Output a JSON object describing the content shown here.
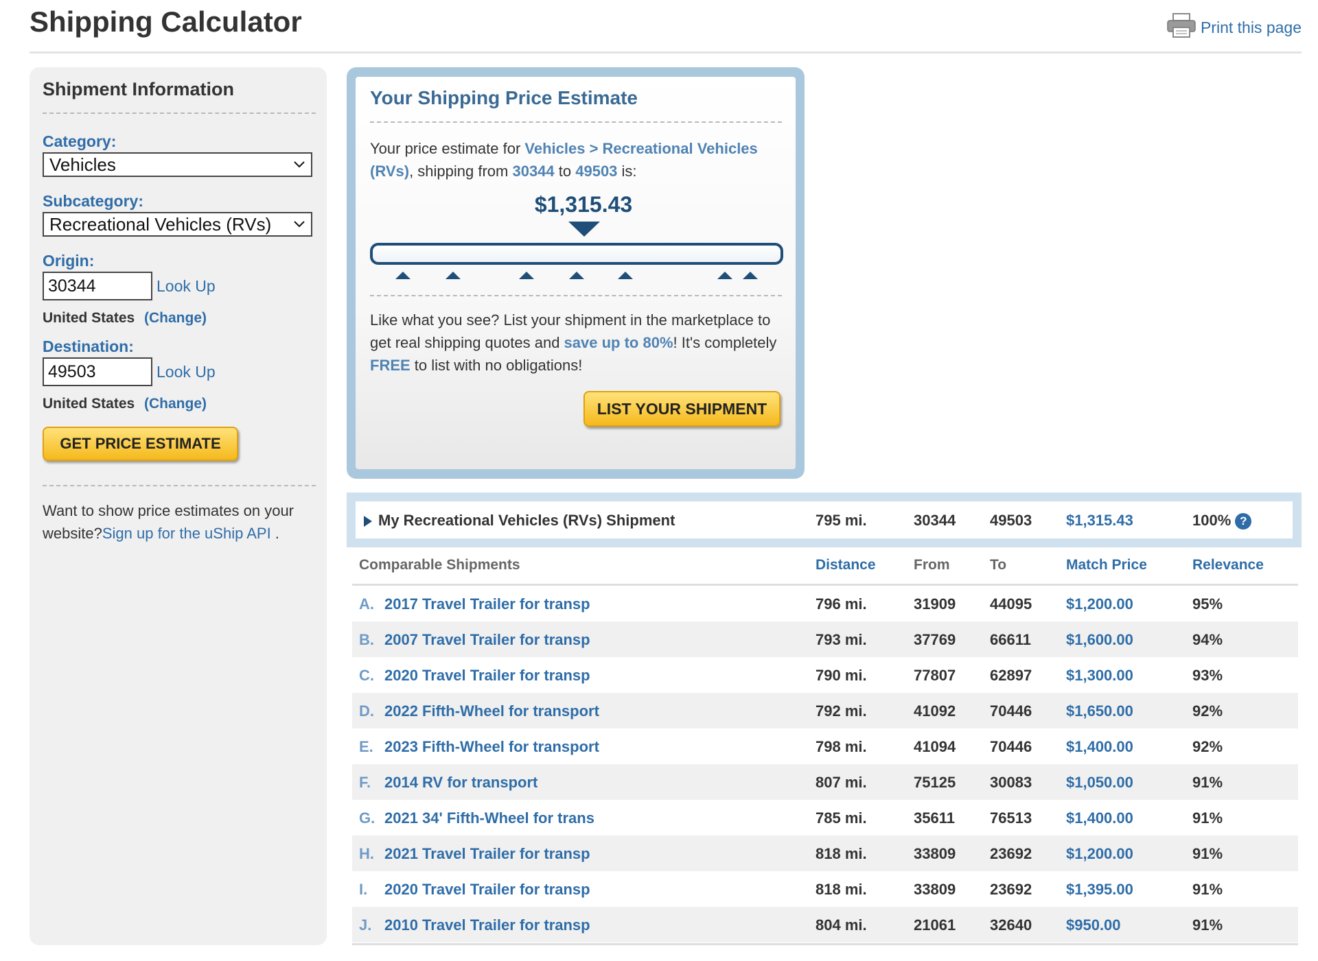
{
  "page": {
    "title": "Shipping Calculator",
    "print_label": "Print this page"
  },
  "sidebar": {
    "heading": "Shipment Information",
    "category_label": "Category:",
    "category_value": "Vehicles",
    "subcategory_label": "Subcategory:",
    "subcategory_value": "Recreational Vehicles (RVs)",
    "origin_label": "Origin:",
    "origin_value": "30344",
    "origin_lookup": "Look Up",
    "origin_country": "United States",
    "origin_change": "(Change)",
    "destination_label": "Destination:",
    "destination_value": "49503",
    "destination_lookup": "Look Up",
    "destination_country": "United States",
    "destination_change": "(Change)",
    "estimate_button": "GET PRICE ESTIMATE",
    "api_text": "Want to show price estimates on your website?",
    "api_link": "Sign up for the uShip API",
    "api_suffix": " ."
  },
  "estimate": {
    "heading": "Your Shipping Price Estimate",
    "intro_prefix": "Your price estimate for ",
    "category_path": "Vehicles > Recreational Vehicles (RVs)",
    "intro_mid1": ", shipping from ",
    "from": "30344",
    "intro_mid2": " to ",
    "to": "49503",
    "intro_suffix": " is:",
    "price": "$1,315.43",
    "cta_text1": "Like what you see? List your shipment in the marketplace to get real shipping quotes and ",
    "cta_highlight1": "save up to 80%",
    "cta_text2": "! It's completely ",
    "cta_highlight2": "FREE",
    "cta_text3": " to list with no obligations!",
    "list_button": "LIST YOUR SHIPMENT"
  },
  "summary": {
    "title": "My Recreational Vehicles (RVs) Shipment",
    "distance": "795 mi.",
    "from": "30344",
    "to": "49503",
    "price": "$1,315.43",
    "relevance": "100%",
    "help_icon": "question-circle-icon"
  },
  "table": {
    "headers": {
      "name": "Comparable Shipments",
      "distance": "Distance",
      "from": "From",
      "to": "To",
      "price": "Match Price",
      "relevance": "Relevance"
    },
    "rows": [
      {
        "letter": "A.",
        "name": "2017 Travel Trailer for transp",
        "distance": "796 mi.",
        "from": "31909",
        "to": "44095",
        "price": "$1,200.00",
        "relevance": "95%"
      },
      {
        "letter": "B.",
        "name": "2007 Travel Trailer for transp",
        "distance": "793 mi.",
        "from": "37769",
        "to": "66611",
        "price": "$1,600.00",
        "relevance": "94%"
      },
      {
        "letter": "C.",
        "name": "2020 Travel Trailer for transp",
        "distance": "790 mi.",
        "from": "77807",
        "to": "62897",
        "price": "$1,300.00",
        "relevance": "93%"
      },
      {
        "letter": "D.",
        "name": "2022 Fifth-Wheel for transport",
        "distance": "792 mi.",
        "from": "41092",
        "to": "70446",
        "price": "$1,650.00",
        "relevance": "92%"
      },
      {
        "letter": "E.",
        "name": "2023 Fifth-Wheel for transport",
        "distance": "798 mi.",
        "from": "41094",
        "to": "70446",
        "price": "$1,400.00",
        "relevance": "92%"
      },
      {
        "letter": "F.",
        "name": "2014 RV for transport",
        "distance": "807 mi.",
        "from": "75125",
        "to": "30083",
        "price": "$1,050.00",
        "relevance": "91%"
      },
      {
        "letter": "G.",
        "name": "2021 34' Fifth-Wheel for trans",
        "distance": "785 mi.",
        "from": "35611",
        "to": "76513",
        "price": "$1,400.00",
        "relevance": "91%"
      },
      {
        "letter": "H.",
        "name": "2021 Travel Trailer for transp",
        "distance": "818 mi.",
        "from": "33809",
        "to": "23692",
        "price": "$1,200.00",
        "relevance": "91%"
      },
      {
        "letter": "I.",
        "name": "2020 Travel Trailer for transp",
        "distance": "818 mi.",
        "from": "33809",
        "to": "23692",
        "price": "$1,395.00",
        "relevance": "91%"
      },
      {
        "letter": "J.",
        "name": "2010 Travel Trailer for transp",
        "distance": "804 mi.",
        "from": "21061",
        "to": "32640",
        "price": "$950.00",
        "relevance": "91%"
      }
    ]
  },
  "icons": {
    "print": "printer-icon",
    "expand": "triangle-right-icon",
    "select_chevron": "chevron-down-icon"
  },
  "colors": {
    "link_blue": "#2f6da8",
    "dark_blue": "#1f4e79",
    "panel_border": "#a9c8de",
    "button_yellow": "#f5b91c"
  }
}
